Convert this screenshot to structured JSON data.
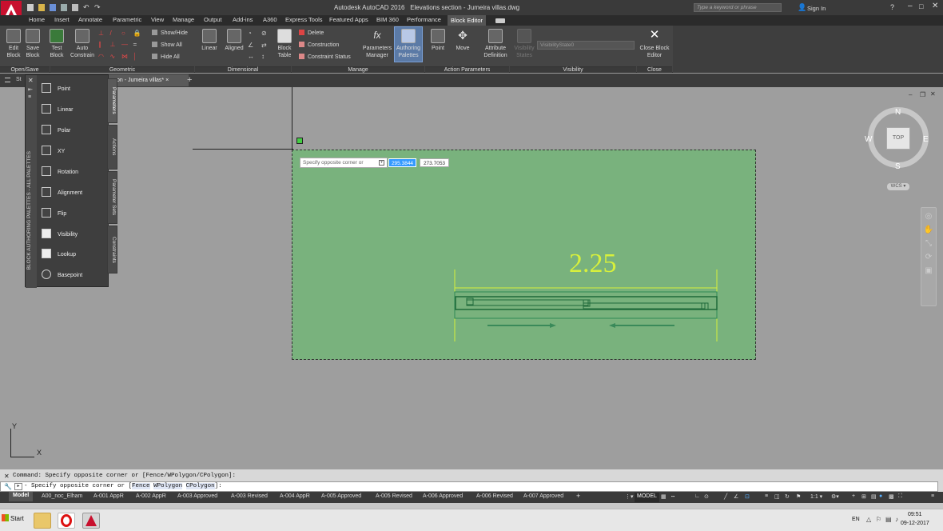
{
  "app": {
    "title": "Autodesk AutoCAD 2016",
    "document": "Elevations section - Jumeira villas.dwg",
    "search_placeholder": "Type a keyword or phrase",
    "sign_in": "Sign In"
  },
  "menu_tabs": [
    "Home",
    "Insert",
    "Annotate",
    "Parametric",
    "View",
    "Manage",
    "Output",
    "Add-ins",
    "A360",
    "Express Tools",
    "Featured Apps",
    "BIM 360",
    "Performance",
    "Block Editor"
  ],
  "ribbon": {
    "buttons": {
      "edit_block": "Edit Block",
      "save_block": "Save Block",
      "test_block": "Test Block",
      "auto_constrain": "Auto Constrain",
      "block_table": "Block Table",
      "parameters_manager": "Parameters Manager",
      "authoring_palettes": "Authoring Palettes",
      "point": "Point",
      "move": "Move",
      "attribute_definition": "Attribute Definition",
      "visibility_states": "Visibility States",
      "close_block_editor": "Close Block Editor",
      "linear": "Linear",
      "aligned": "Aligned"
    },
    "small": {
      "show_hide": "Show/Hide",
      "show_all": "Show All",
      "hide_all": "Hide All",
      "delete": "Delete",
      "construction": "Construction",
      "constraint_status": "Constraint Status"
    },
    "visibility_state": "VisibilityState0",
    "panels": {
      "open_save": "Open/Save",
      "geometric": "Geometric",
      "dimensional": "Dimensional",
      "manage": "Manage",
      "action_parameters": "Action Parameters",
      "visibility": "Visibility",
      "close": "Close"
    }
  },
  "doc_tabs": {
    "start": "St",
    "current": "on - Jumeira villas*"
  },
  "palette": {
    "title": "BLOCK AUTHORING PALETTES - ALL PALETTES",
    "items": [
      "Point",
      "Linear",
      "Polar",
      "XY",
      "Rotation",
      "Alignment",
      "Flip",
      "Visibility",
      "Lookup",
      "Basepoint"
    ],
    "side_tabs": [
      "Parameters",
      "Actions",
      "Parameter Sets",
      "Constraints"
    ]
  },
  "drawing": {
    "dimension_text": "2.25",
    "prompt_label": "Specify opposite corner or",
    "value_x": "295.3844",
    "value_y": "273.7053"
  },
  "viewcube": {
    "n": "N",
    "s": "S",
    "e": "E",
    "w": "W",
    "top": "TOP",
    "wcs": "WCS"
  },
  "ucs": {
    "x": "X",
    "y": "Y"
  },
  "command": {
    "history": "Command: Specify opposite corner or [Fence/WPolygon/CPolygon]:",
    "prompt_prefix": "- Specify opposite corner or [",
    "opt1": "Fence",
    "opt2": "WPolygon",
    "opt3": "CPolygon",
    "prompt_suffix": "]:"
  },
  "layouts": [
    "Model",
    "A00_noc_Elham",
    "A-001 AppR",
    "A-002 AppR",
    "A-003 Approved",
    "A-003 Revised",
    "A-004 AppR",
    "A-005 Approved",
    "A-005 Revised",
    "A-006 Approved",
    "A-006 Revised",
    "A-007 Approved"
  ],
  "status": {
    "model": "MODEL",
    "scale": "1:1"
  },
  "taskbar": {
    "start": "Start",
    "lang": "EN",
    "time": "09:51",
    "date": "09-12-2017"
  },
  "colors": {
    "selection_fill": "#79b27d",
    "dimension": "#d7f03c",
    "accent": "#3b7ec8"
  }
}
